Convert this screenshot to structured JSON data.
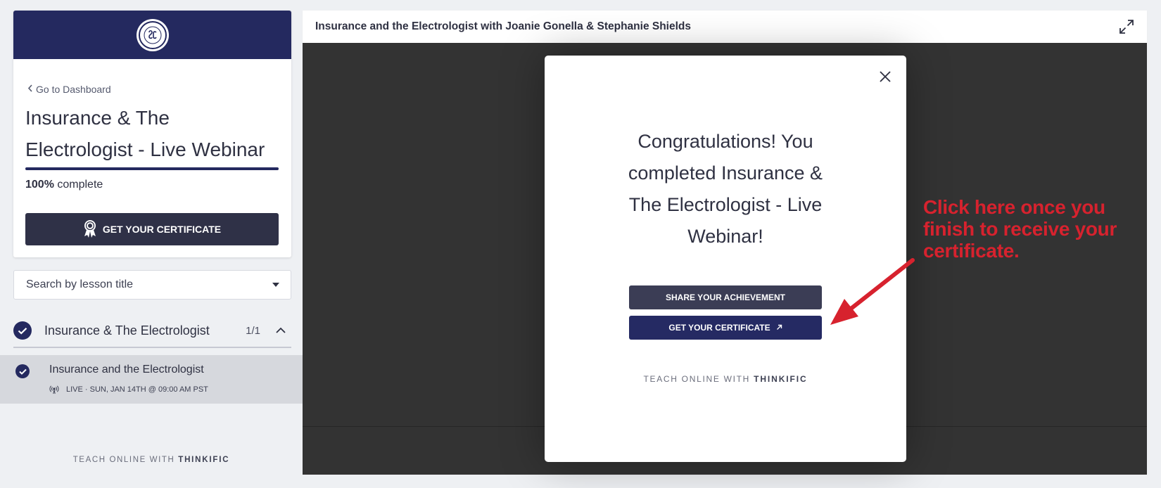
{
  "sidebar": {
    "back_link": "Go to Dashboard",
    "course_title": "Insurance & The Electrologist - Live Webinar",
    "progress": {
      "percent_value": 100,
      "percent_label": "100%",
      "suffix": "complete"
    },
    "certificate_button": "GET YOUR CERTIFICATE",
    "search_placeholder": "Search by lesson title",
    "chapter": {
      "title": "Insurance & The Electrologist",
      "count": "1/1",
      "completed": true
    },
    "lesson": {
      "title": "Insurance and the Electrologist",
      "meta": "LIVE · SUN, JAN 14TH @ 09:00 AM PST",
      "completed": true
    },
    "footer": {
      "prefix": "TEACH ONLINE WITH",
      "brand": "THINKIFIC"
    }
  },
  "main": {
    "title": "Insurance and the Electrologist with Joanie Gonella & Stephanie Shields"
  },
  "modal": {
    "heading": "Congratulations! You completed Insurance & The Electrologist - Live Webinar!",
    "share_button": "SHARE YOUR ACHIEVEMENT",
    "certificate_button": "GET YOUR CERTIFICATE",
    "footer": {
      "prefix": "TEACH ONLINE WITH",
      "brand": "THINKIFIC"
    }
  },
  "annotation": {
    "text": "Click here once you finish to receive your certificate."
  },
  "colors": {
    "brand_navy": "#24295f",
    "dark_button": "#2f3147",
    "annotation_red": "#d7222e",
    "video_bg": "#333333"
  },
  "icons": [
    "chevron-left-icon",
    "award-ribbon-icon",
    "caret-down-icon",
    "check-icon",
    "chevron-up-icon",
    "broadcast-icon",
    "expand-icon",
    "close-icon",
    "external-link-icon",
    "arrow-annotation-icon"
  ]
}
